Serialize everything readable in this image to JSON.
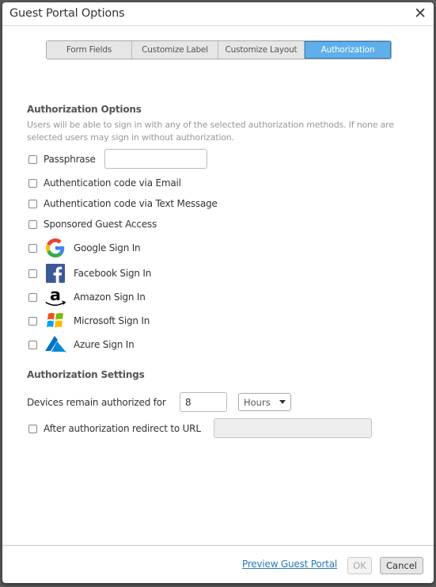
{
  "dialog": {
    "title": "Guest Portal Options",
    "close_icon": "close-icon"
  },
  "tabs": [
    {
      "label": "Form Fields",
      "active": false
    },
    {
      "label": "Customize Label",
      "active": false
    },
    {
      "label": "Customize Layout",
      "active": false
    },
    {
      "label": "Authorization",
      "active": true
    }
  ],
  "authorization_options": {
    "title": "Authorization Options",
    "description": "Users will be able to sign in with any of the selected authorization methods. If none are selected users may sign in without authorization.",
    "passphrase": {
      "label": "Passphrase",
      "checked": false,
      "value": ""
    },
    "methods": [
      {
        "label": "Authentication code via Email",
        "checked": false
      },
      {
        "label": "Authentication code via Text Message",
        "checked": false
      },
      {
        "label": "Sponsored Guest Access",
        "checked": false
      }
    ],
    "providers": [
      {
        "label": "Google Sign In",
        "icon": "google-icon",
        "checked": false
      },
      {
        "label": "Facebook Sign In",
        "icon": "facebook-icon",
        "checked": false
      },
      {
        "label": "Amazon Sign In",
        "icon": "amazon-icon",
        "checked": false
      },
      {
        "label": "Microsoft Sign In",
        "icon": "microsoft-icon",
        "checked": false
      },
      {
        "label": "Azure Sign In",
        "icon": "azure-icon",
        "checked": false
      }
    ]
  },
  "authorization_settings": {
    "title": "Authorization Settings",
    "duration_label": "Devices remain authorized for",
    "duration_value": "8",
    "duration_unit": "Hours",
    "redirect": {
      "label": "After authorization redirect to URL",
      "checked": false,
      "value": ""
    }
  },
  "footer": {
    "preview_link": "Preview Guest Portal",
    "ok_label": "OK",
    "cancel_label": "Cancel"
  },
  "colors": {
    "active_tab": "#5fb0ea",
    "link": "#2a78b8"
  }
}
